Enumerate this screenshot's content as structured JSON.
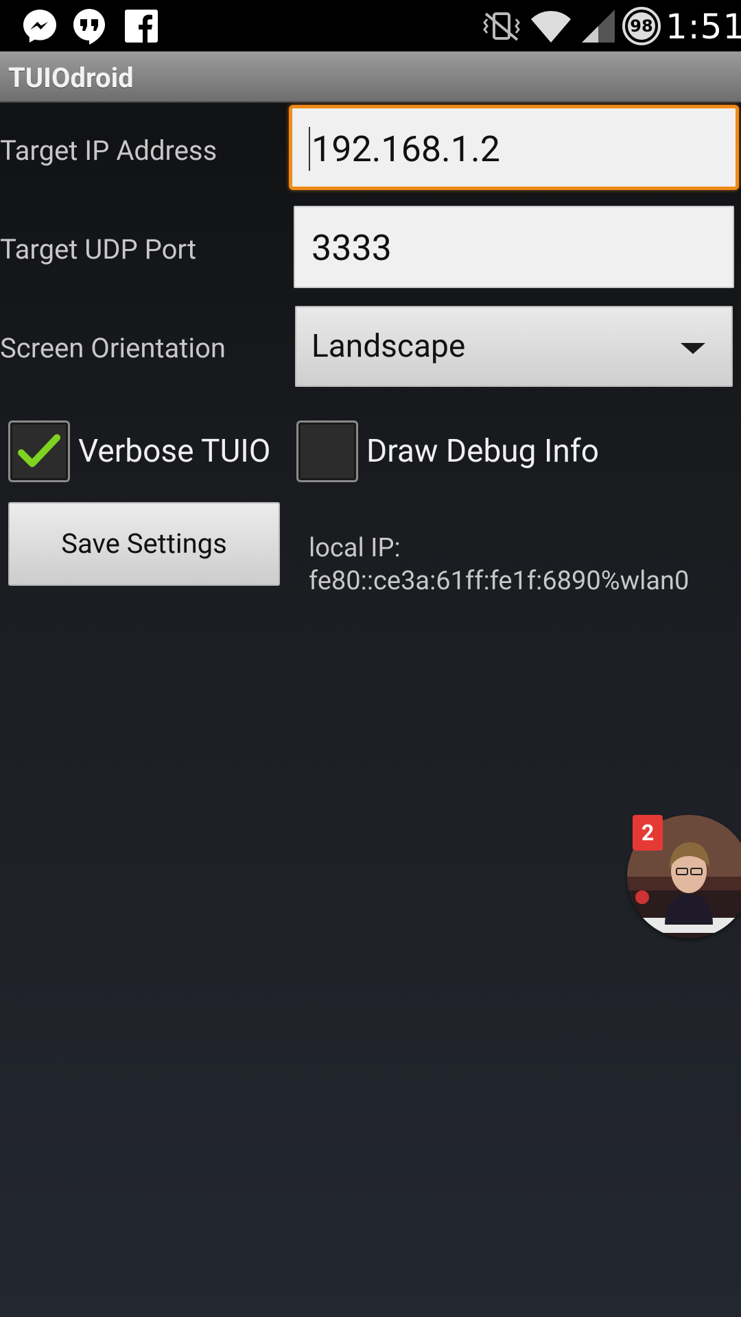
{
  "status_bar": {
    "time": "1:51",
    "battery_level": "98",
    "notification_icons": [
      "messenger-icon",
      "hangouts-icon",
      "facebook-icon"
    ],
    "system_icons": [
      "vibrate-icon",
      "wifi-icon",
      "signal-icon",
      "battery-icon"
    ]
  },
  "action_bar": {
    "title": "TUIOdroid"
  },
  "form": {
    "ip": {
      "label": "Target IP Address",
      "value": "192.168.1.2"
    },
    "port": {
      "label": "Target UDP Port",
      "value": "3333"
    },
    "orientation": {
      "label": "Screen Orientation",
      "value": "Landscape"
    },
    "verbose": {
      "label": "Verbose TUIO",
      "checked": true
    },
    "debug": {
      "label": "Draw Debug Info",
      "checked": false
    },
    "save_label": "Save Settings",
    "local_ip_label": "local IP:",
    "local_ip_value": "fe80::ce3a:61ff:fe1f:6890%wlan0"
  },
  "chat_head": {
    "badge_count": "2"
  },
  "colors": {
    "focus_accent": "#f08a17",
    "check_green": "#7ed321",
    "badge_red": "#e53935"
  }
}
